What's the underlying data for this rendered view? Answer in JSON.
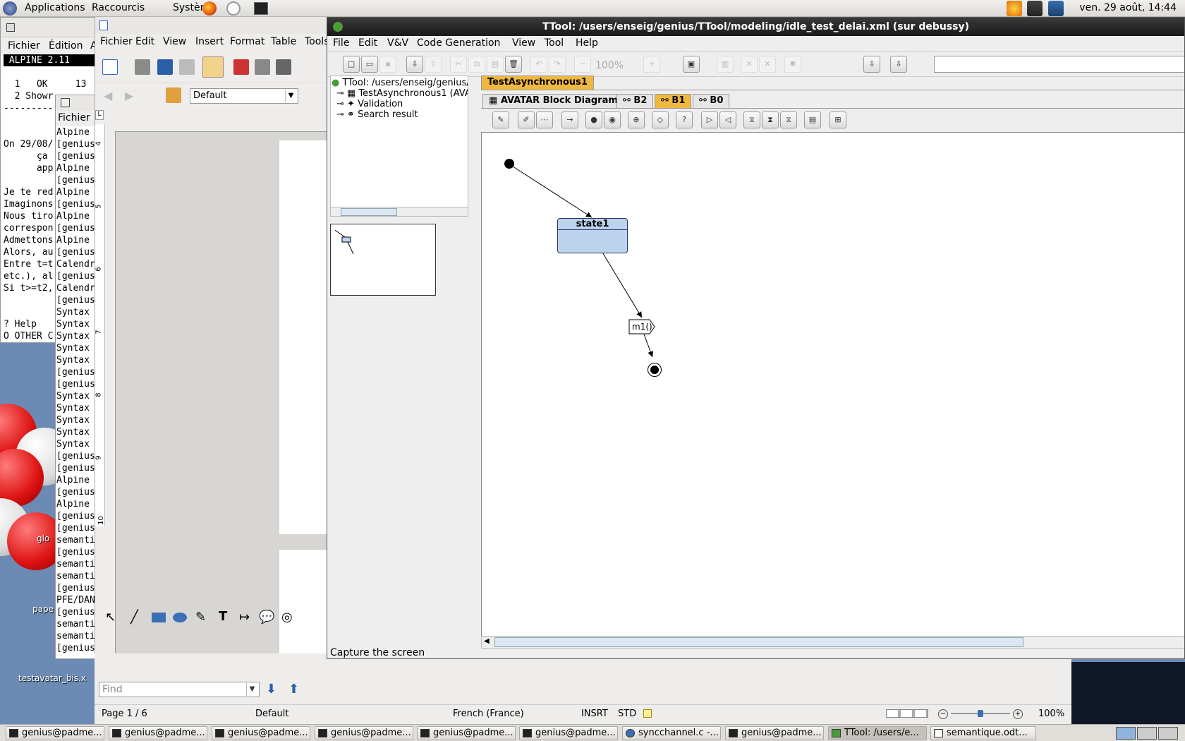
{
  "top_panel": {
    "menus": [
      "Applications",
      "Raccourcis",
      "Système"
    ],
    "clock": "ven. 29 août, 14:44"
  },
  "alpine": {
    "menu": [
      "Fichier",
      "Édition",
      "A"
    ],
    "header": " ALPINE 2.11 ",
    "lines": [
      "",
      "  1   OK     13",
      "  2 Showr",
      "---------",
      "",
      "",
      "On 29/08/",
      "      ça ",
      "      app",
      "",
      "Je te red",
      "Imaginons",
      "Nous tiro",
      "correspon",
      "Admettons",
      "Alors, au",
      "Entre t=t",
      "etc.), al",
      "Si t>=t2,",
      "",
      "",
      "? Help",
      "O OTHER C"
    ]
  },
  "term2": {
    "menu": "Fichier",
    "lines": [
      "Alpine ",
      "[genius",
      "[genius",
      "Alpine ",
      "[genius",
      "Alpine ",
      "[genius",
      "Alpine ",
      "[genius",
      "Alpine ",
      "[genius",
      "Calendr",
      "[genius",
      "Calendr",
      "[genius",
      "Syntax ",
      "Syntax ",
      "Syntax ",
      "Syntax ",
      "Syntax ",
      "[genius",
      "[genius",
      "Syntax ",
      "Syntax ",
      "Syntax ",
      "Syntax ",
      "Syntax ",
      "[genius",
      "[genius",
      "Alpine ",
      "[genius",
      "Alpine ",
      "[genius",
      "[genius",
      "semanti",
      "[genius",
      "semanti",
      "semanti",
      "[genius",
      "PFE/DAN",
      "[genius",
      "semanti",
      "semanti",
      "[genius"
    ]
  },
  "libreoffice": {
    "menu": [
      "Fichier",
      "Edit",
      "View",
      "Insert",
      "Format",
      "Table",
      "Tools"
    ],
    "style_value": "Default",
    "find_placeholder": "Find",
    "status": {
      "page": "Page 1 / 6",
      "style": "Default",
      "language": "French (France)",
      "insert": "INSRT",
      "selection": "STD",
      "zoom": "100%"
    },
    "ruler_numbers": [
      "4",
      "5",
      "6",
      "7",
      "8",
      "9",
      "10"
    ]
  },
  "desktop": {
    "labels": [
      "glo",
      "pape",
      "testavatar_bis.x"
    ]
  },
  "ttool": {
    "title": "TTool: /users/enseig/genius/TTool/modeling/idle_test_delai.xml (sur debussy)",
    "menu": [
      "File",
      "Edit",
      "V&V",
      "Code Generation",
      "View",
      "Tool",
      "Help"
    ],
    "zoom": "100%",
    "tree": {
      "root": "TTool: /users/enseig/genius/T",
      "items": [
        "TestAsynchronous1 (AVAT",
        "Validation",
        "Search result"
      ]
    },
    "top_tab": "TestAsynchronous1",
    "tabs": [
      "AVATAR Block Diagram",
      "B2",
      "B1",
      "B0"
    ],
    "active_tab": "B1",
    "diagram": {
      "state_name": "state1",
      "signal_label": "m1()"
    },
    "status": "Capture the screen"
  },
  "taskbar": {
    "tasks": [
      "genius@padme...",
      "genius@padme...",
      "genius@padme...",
      "genius@padme...",
      "genius@padme...",
      "genius@padme...",
      "syncchannel.c -...",
      "genius@padme...",
      "TTool: /users/e...",
      "semantique.odt..."
    ]
  }
}
